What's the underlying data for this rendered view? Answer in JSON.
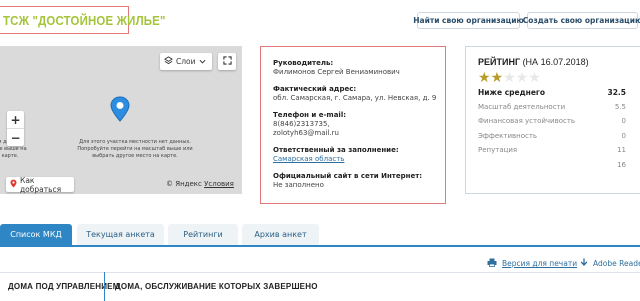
{
  "header": {
    "org_title": "ТСЖ \"ДОСТОЙНОЕ ЖИЛЬЕ\"",
    "find_button": "Найти свою организацию",
    "create_button": "Создать свою организацию"
  },
  "map": {
    "layers_label": "Слои",
    "zoom_in": "+",
    "zoom_out": "−",
    "no_data_note": "Для этого участка местности нет данных. Попробуйте перейти на масштаб выше или выбрать другое место на карте.",
    "no_data_note_left": "тя данных. ите выше на карте.",
    "route_button": "Как добраться",
    "copyright": "© Яндекс",
    "terms_link": "Условия"
  },
  "info": {
    "head_label": "Руководитель:",
    "head_value": "Филимонов Сергей Вениаминович",
    "address_label": "Фактический адрес:",
    "address_value": "обл. Самарская, г. Самара, ул. Невская, д. 9",
    "phone_label": "Телефон и e-mail:",
    "phone_value": "8(846)2313735,",
    "email_value": "zolotyh63@mail.ru",
    "responsible_label": "Ответственный за заполнение:",
    "responsible_value": "Самарская область",
    "site_label": "Официальный сайт в сети Интернет:",
    "site_value": "Не заполнено"
  },
  "rating": {
    "title": "РЕЙТИНГ",
    "date": "(НА 16.07.2018)",
    "stars_filled": 2,
    "stars_total": 5,
    "rows": [
      {
        "label": "Ниже среднего",
        "value": "32.5"
      },
      {
        "label": "Масштаб деятельности",
        "value": "5.5"
      },
      {
        "label": "Финансовая устойчивость",
        "value": "0"
      },
      {
        "label": "Эффективность",
        "value": "0"
      },
      {
        "label": "Репутация",
        "value": "11"
      },
      {
        "label": "",
        "value": "16"
      }
    ]
  },
  "tabs": [
    {
      "label": "Список МКД",
      "active": true
    },
    {
      "label": "Текущая анкета",
      "active": false
    },
    {
      "label": "Рейтинги",
      "active": false
    },
    {
      "label": "Архив анкет",
      "active": false
    }
  ],
  "print_link": "Версия для печати",
  "adobe_link": "Adobe Reader",
  "bottom_tabs": [
    {
      "label": "ДОМА ПОД УПРАВЛЕНИЕМ"
    },
    {
      "label": "ДОМА, ОБСЛУЖИВАНИЕ КОТОРЫХ ЗАВЕРШЕНО"
    }
  ],
  "colors": {
    "accent": "#2f86c4",
    "title_green": "#a4c43a",
    "star_gold": "#b89c2a",
    "highlight_border": "#e07a7a"
  }
}
